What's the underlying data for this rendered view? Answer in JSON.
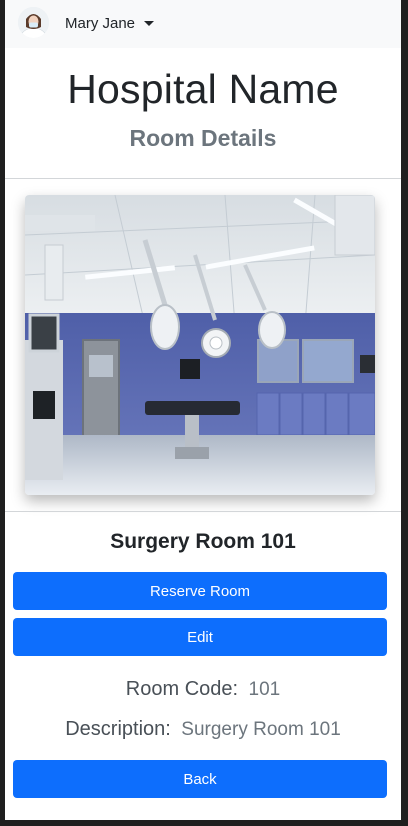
{
  "navbar": {
    "user_name": "Mary Jane"
  },
  "header": {
    "hospital_name": "Hospital Name",
    "subtitle": "Room Details"
  },
  "room": {
    "title": "Surgery Room 101",
    "code_label": "Room Code:",
    "code_value": "101",
    "description_label": "Description:",
    "description_value": "Surgery Room 101"
  },
  "actions": {
    "reserve_label": "Reserve Room",
    "edit_label": "Edit",
    "back_label": "Back"
  },
  "colors": {
    "primary": "#0d6efd",
    "navbar_bg": "#f8f9fa",
    "muted_text": "#6c757d"
  },
  "icons": {
    "user_menu_toggle": "caret-down-icon"
  }
}
